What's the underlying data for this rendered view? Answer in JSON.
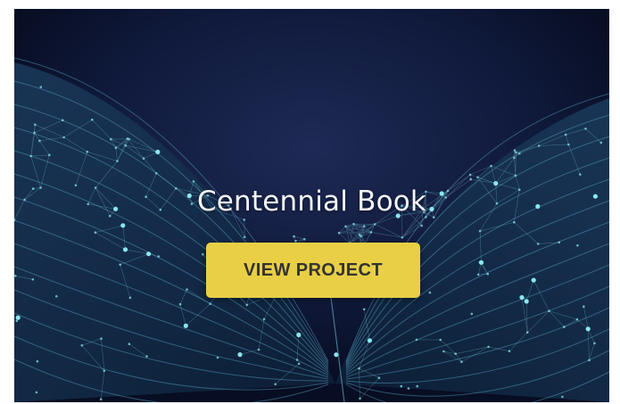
{
  "card": {
    "title": "Centennial Book",
    "button_label": "VIEW PROJECT",
    "background_image": "open-book-network-illustration"
  },
  "colors": {
    "background": "#0b1430",
    "button": "#e8cf45",
    "button_text": "#333333",
    "title_text": "#f4f6fa",
    "network_glow": "#4fd4e0"
  }
}
